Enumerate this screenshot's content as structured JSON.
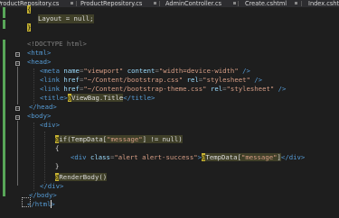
{
  "tabs": [
    {
      "label": "IProductRepository.cs"
    },
    {
      "label": "ProductRepository.cs"
    },
    {
      "label": "AdminController.cs"
    },
    {
      "label": "Create.cshtml"
    },
    {
      "label": "Index.csht"
    }
  ],
  "code": {
    "l1_brace": "{",
    "l2_text": "Layout = null;",
    "l3_brace": "}",
    "l5_doctype": "<!DOCTYPE html>",
    "l6": "<html>",
    "l7": "<head>",
    "l8_open": "<meta ",
    "l8_attr1": "name",
    "l8_eq1": "=",
    "l8_val1": "\"viewport\"",
    "l8_attr2": "content",
    "l8_eq2": "=",
    "l8_val2": "\"width=device-width\"",
    "l8_close": " />",
    "l9_open": "<link ",
    "l9_attr1": "href",
    "l9_eq1": "=",
    "l9_val1": "\"~/Content/bootstrap.css\"",
    "l9_attr2": "rel",
    "l9_eq2": "=",
    "l9_val2": "\"stylesheet\"",
    "l9_close": " />",
    "l10_open": "<link ",
    "l10_attr1": "href",
    "l10_eq1": "=",
    "l10_val1": "\"~/Content/bootstrap-theme.css\"",
    "l10_attr2": "rel",
    "l10_eq2": "=",
    "l10_val2": "\"stylesheet\"",
    "l10_close": " />",
    "l11_open": "<title>",
    "l11_expr": "ViewBag.Title",
    "l11_close": "</title>",
    "l12": "</head>",
    "l13": "<body>",
    "l14": "<div>",
    "l16_expr": "if(TempData[",
    "l16_str": "\"message\"",
    "l16_rest": "] != null)",
    "l17_brace": "{",
    "l18_open": "<div ",
    "l18_attr": "class",
    "l18_eq": "=",
    "l18_val": "\"alert alert-success\"",
    "l18_gt": ">",
    "l18_expr": "TempData[",
    "l18_str": "\"message\"",
    "l18_exprend": "]",
    "l18_close": "</div>",
    "l19_brace": "}",
    "l21_expr": "RenderBody()",
    "l22": "</div>",
    "l23": "</body>",
    "l24": "</html>"
  },
  "colors": {
    "background": "#1e1e1e",
    "keyword": "#569cd6",
    "attribute": "#9cdcfe",
    "string": "#d69d85",
    "razor_marker": "#c9b533",
    "modified_bar": "#58a658"
  }
}
